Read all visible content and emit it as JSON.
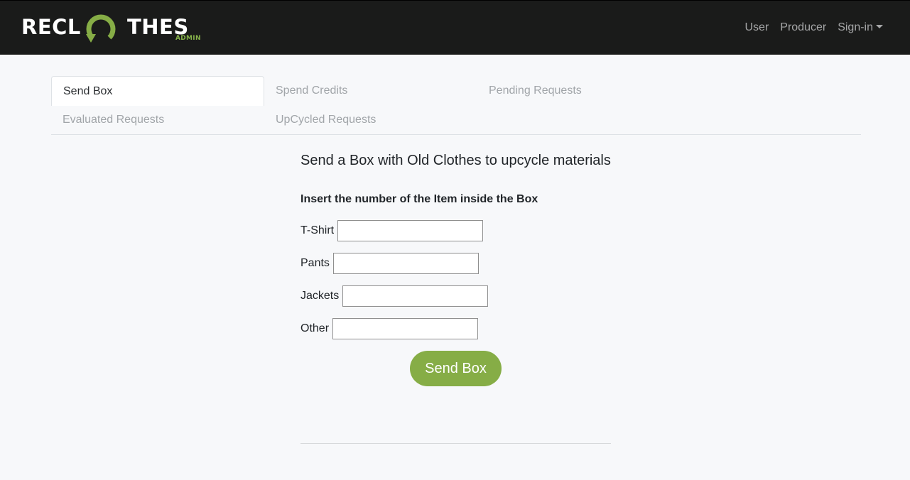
{
  "brand": {
    "logo_left": "RECL",
    "logo_right": "THES",
    "logo_sub": "ADMIN",
    "accent_color": "#86ad46"
  },
  "navbar": {
    "links": [
      "User",
      "Producer",
      "Sign-in"
    ]
  },
  "tabs": [
    {
      "label": "Send Box",
      "active": true
    },
    {
      "label": "Spend Credits",
      "active": false
    },
    {
      "label": "Pending Requests",
      "active": false
    },
    {
      "label": "Evaluated Requests",
      "active": false
    },
    {
      "label": "UpCycled Requests",
      "active": false
    }
  ],
  "main": {
    "title": "Send a Box with Old Clothes to upcycle materials",
    "subtitle": "Insert the number of the Item inside the Box",
    "fields": [
      {
        "label": "T-Shirt",
        "value": ""
      },
      {
        "label": "Pants",
        "value": ""
      },
      {
        "label": "Jackets",
        "value": ""
      },
      {
        "label": "Other",
        "value": ""
      }
    ],
    "submit_label": "Send Box"
  }
}
